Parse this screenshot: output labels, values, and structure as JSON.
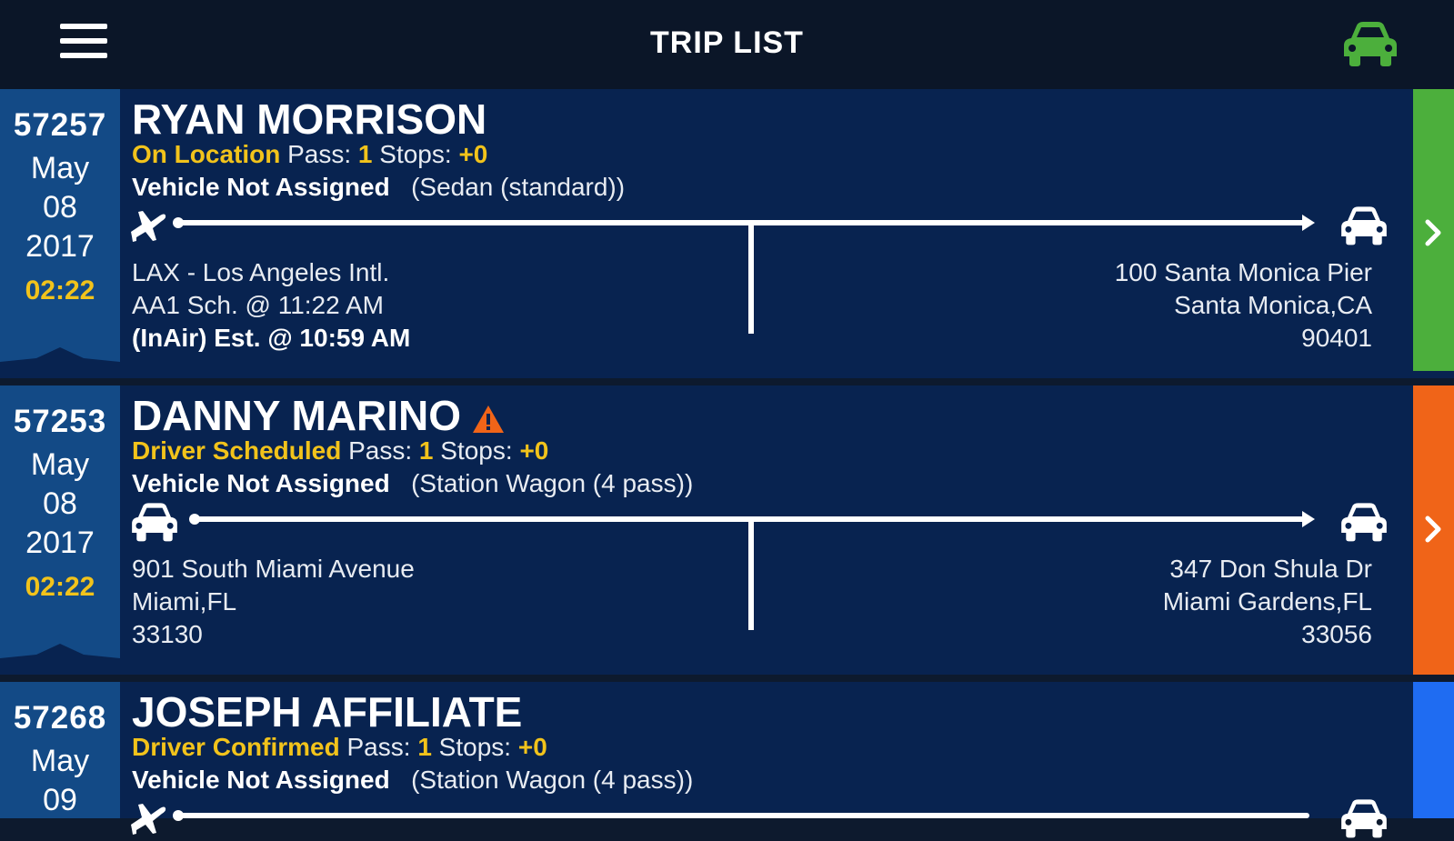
{
  "header": {
    "title": "TRIP LIST",
    "menu_icon": "hamburger-menu-icon",
    "right_icon": "car-icon",
    "right_icon_color": "#4caf3c"
  },
  "colors": {
    "header_bg": "#0b1628",
    "card_bg": "#082350",
    "date_col_bg": "#134a86",
    "status_yellow": "#f2c31b",
    "warning_orange": "#f06418"
  },
  "trips": [
    {
      "id": "57257",
      "month": "May",
      "day": "08",
      "year": "2017",
      "time": "02:22",
      "name": "RYAN MORRISON",
      "warning": false,
      "status": "On Location",
      "pass_label": "Pass:",
      "pass": "1",
      "stops_label": "Stops:",
      "stops": "+0",
      "vehicle": "Vehicle Not Assigned",
      "vehicle_type": "(Sedan (standard))",
      "pickup_icon": "airplane-icon",
      "dropoff_icon": "car-icon",
      "pickup_lines": [
        "LAX  - Los Angeles Intl.",
        "AA1 Sch. @ 11:22 AM",
        "(InAir) Est. @ 10:59 AM"
      ],
      "dropoff_lines": [
        "100 Santa Monica Pier",
        "Santa Monica,CA",
        "90401"
      ],
      "side_color": "#4caf3c"
    },
    {
      "id": "57253",
      "month": "May",
      "day": "08",
      "year": "2017",
      "time": "02:22",
      "name": "DANNY MARINO",
      "warning": true,
      "status": "Driver Scheduled",
      "pass_label": "Pass:",
      "pass": "1",
      "stops_label": "Stops:",
      "stops": "+0",
      "vehicle": "Vehicle Not Assigned",
      "vehicle_type": "(Station Wagon (4 pass))",
      "pickup_icon": "car-icon",
      "dropoff_icon": "car-icon",
      "pickup_lines": [
        "901 South Miami Avenue",
        "Miami,FL",
        "33130"
      ],
      "dropoff_lines": [
        "347 Don Shula Dr",
        "Miami Gardens,FL",
        "33056"
      ],
      "side_color": "#f06418"
    },
    {
      "id": "57268",
      "month": "May",
      "day": "09",
      "year": "",
      "time": "",
      "name": "JOSEPH AFFILIATE",
      "warning": false,
      "status": "Driver Confirmed",
      "pass_label": "Pass:",
      "pass": "1",
      "stops_label": "Stops:",
      "stops": "+0",
      "vehicle": "Vehicle Not Assigned",
      "vehicle_type": "(Station Wagon (4 pass))",
      "pickup_icon": "airplane-icon",
      "dropoff_icon": "car-icon",
      "pickup_lines": [],
      "dropoff_lines": [],
      "side_color": "#1f6cf2"
    }
  ]
}
